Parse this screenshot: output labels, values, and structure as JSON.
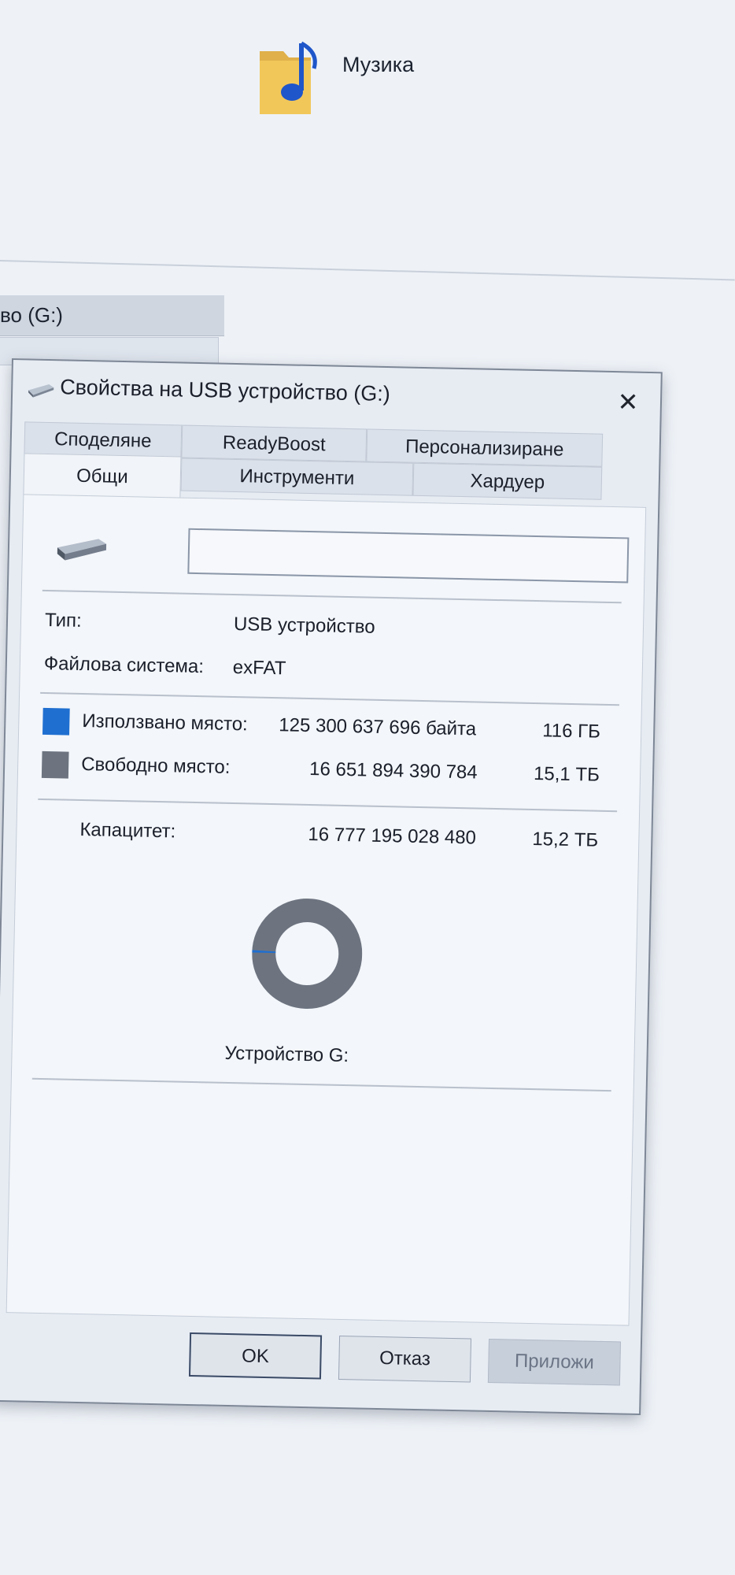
{
  "explorer": {
    "music_folder_label": "Музика",
    "drive_tab_label": "во (G:)"
  },
  "dialog": {
    "title": "Свойства на USB устройство (G:)",
    "close_symbol": "✕",
    "tabs": [
      {
        "label": "Споделяне"
      },
      {
        "label": "ReadyBoost"
      },
      {
        "label": "Персонализиране"
      },
      {
        "label": "Общи"
      },
      {
        "label": "Инструменти"
      },
      {
        "label": "Хардуер"
      }
    ],
    "selected_tab": "Общи",
    "volume_name_value": "",
    "type_label": "Тип:",
    "type_value": "USB устройство",
    "fs_label": "Файлова система:",
    "fs_value": "exFAT",
    "used_label": "Използвано място:",
    "used_bytes": "125 300 637 696 байта",
    "used_size": "116 ГБ",
    "free_label": "Свободно място:",
    "free_bytes": "16 651 894 390 784",
    "free_size": "15,1 ТБ",
    "capacity_label": "Капацитет:",
    "capacity_bytes": "16 777 195 028 480",
    "capacity_size": "15,2 ТБ",
    "drive_caption": "Устройство G:",
    "colors": {
      "used": "#1f6fd0",
      "free": "#6d7480"
    },
    "usage_fraction_used": 0.0075,
    "buttons": {
      "ok": "OK",
      "cancel": "Отказ",
      "apply": "Приложи"
    }
  }
}
